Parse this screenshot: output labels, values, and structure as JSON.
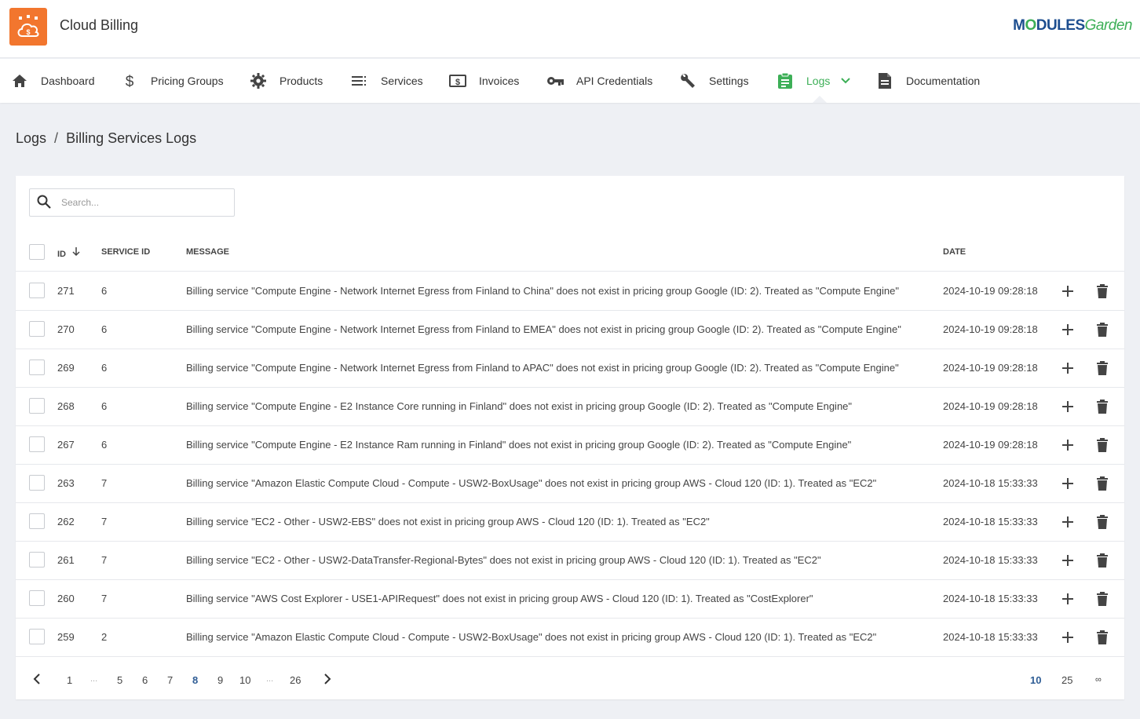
{
  "header": {
    "title": "Cloud Billing",
    "brand_first": "M",
    "brand_o": "O",
    "brand_rest": "DULES",
    "brand_garden": "Garden"
  },
  "nav": {
    "items": [
      {
        "label": "Dashboard",
        "icon": "home-icon"
      },
      {
        "label": "Pricing Groups",
        "icon": "dollar-icon"
      },
      {
        "label": "Products",
        "icon": "gear-icon"
      },
      {
        "label": "Services",
        "icon": "list-icon"
      },
      {
        "label": "Invoices",
        "icon": "invoice-icon"
      },
      {
        "label": "API Credentials",
        "icon": "key-icon"
      },
      {
        "label": "Settings",
        "icon": "wrench-icon"
      },
      {
        "label": "Logs",
        "icon": "clipboard-icon",
        "active": true
      },
      {
        "label": "Documentation",
        "icon": "document-icon"
      }
    ],
    "active_color": "#3daf57"
  },
  "breadcrumb": {
    "root": "Logs",
    "separator": "/",
    "current": "Billing Services Logs"
  },
  "search": {
    "placeholder": "Search..."
  },
  "table": {
    "columns": {
      "id": "ID",
      "service_id": "SERVICE ID",
      "message": "MESSAGE",
      "date": "DATE"
    },
    "rows": [
      {
        "id": "271",
        "service_id": "6",
        "message": "Billing service \"Compute Engine - Network Internet Egress from Finland to China\" does not exist in pricing group Google (ID: 2). Treated as \"Compute Engine\"",
        "date": "2024-10-19 09:28:18"
      },
      {
        "id": "270",
        "service_id": "6",
        "message": "Billing service \"Compute Engine - Network Internet Egress from Finland to EMEA\" does not exist in pricing group Google (ID: 2). Treated as \"Compute Engine\"",
        "date": "2024-10-19 09:28:18"
      },
      {
        "id": "269",
        "service_id": "6",
        "message": "Billing service \"Compute Engine - Network Internet Egress from Finland to APAC\" does not exist in pricing group Google (ID: 2). Treated as \"Compute Engine\"",
        "date": "2024-10-19 09:28:18"
      },
      {
        "id": "268",
        "service_id": "6",
        "message": "Billing service \"Compute Engine - E2 Instance Core running in Finland\" does not exist in pricing group Google (ID: 2). Treated as \"Compute Engine\"",
        "date": "2024-10-19 09:28:18"
      },
      {
        "id": "267",
        "service_id": "6",
        "message": "Billing service \"Compute Engine - E2 Instance Ram running in Finland\" does not exist in pricing group Google (ID: 2). Treated as \"Compute Engine\"",
        "date": "2024-10-19 09:28:18"
      },
      {
        "id": "263",
        "service_id": "7",
        "message": "Billing service \"Amazon Elastic Compute Cloud - Compute - USW2-BoxUsage\" does not exist in pricing group AWS - Cloud 120 (ID: 1). Treated as \"EC2\"",
        "date": "2024-10-18 15:33:33"
      },
      {
        "id": "262",
        "service_id": "7",
        "message": "Billing service \"EC2 - Other - USW2-EBS\" does not exist in pricing group AWS - Cloud 120 (ID: 1). Treated as \"EC2\"",
        "date": "2024-10-18 15:33:33"
      },
      {
        "id": "261",
        "service_id": "7",
        "message": "Billing service \"EC2 - Other - USW2-DataTransfer-Regional-Bytes\" does not exist in pricing group AWS - Cloud 120 (ID: 1). Treated as \"EC2\"",
        "date": "2024-10-18 15:33:33"
      },
      {
        "id": "260",
        "service_id": "7",
        "message": "Billing service \"AWS Cost Explorer - USE1-APIRequest\" does not exist in pricing group AWS - Cloud 120 (ID: 1). Treated as \"CostExplorer\"",
        "date": "2024-10-18 15:33:33"
      },
      {
        "id": "259",
        "service_id": "2",
        "message": "Billing service \"Amazon Elastic Compute Cloud - Compute - USW2-BoxUsage\" does not exist in pricing group AWS - Cloud 120 (ID: 1). Treated as \"EC2\"",
        "date": "2024-10-18 15:33:33"
      }
    ]
  },
  "pagination": {
    "pages": [
      "1",
      "5",
      "6",
      "7",
      "8",
      "9",
      "10",
      "26"
    ],
    "current_page": "8",
    "ellipsis": "...",
    "page_sizes": [
      "10",
      "25",
      "∞"
    ],
    "current_page_size": "10"
  },
  "colors": {
    "accent_green": "#3daf57",
    "logo_orange": "#f2762e",
    "link_blue": "#2f5d95"
  }
}
